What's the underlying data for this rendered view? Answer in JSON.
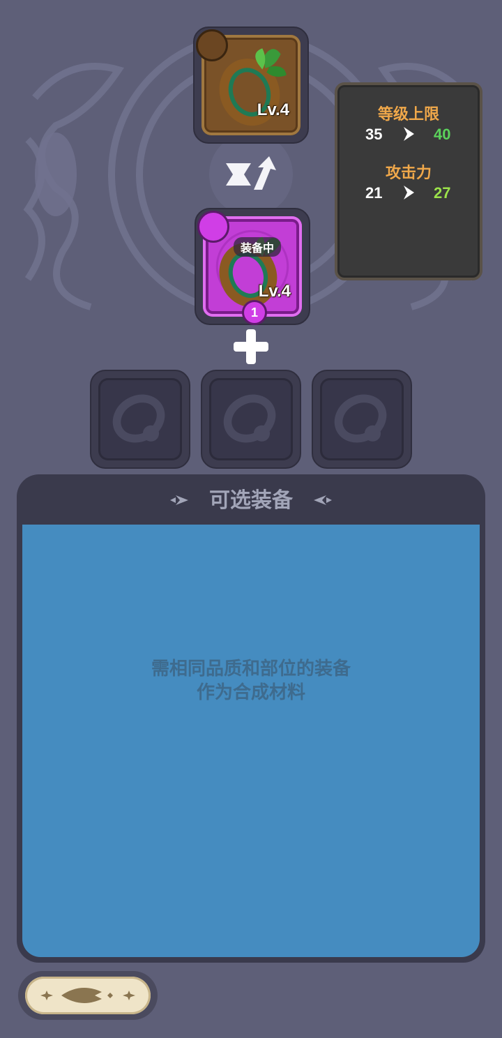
{
  "result_item": {
    "level": "Lv.4",
    "icon": "ring-icon"
  },
  "equipped_item": {
    "level": "Lv.4",
    "tag": "装备中",
    "count": "1",
    "icon": "ring-icon"
  },
  "stats": {
    "level_cap": {
      "label": "等级上限",
      "old": "35",
      "new": "40"
    },
    "attack": {
      "label": "攻击力",
      "old": "21",
      "new": "27"
    }
  },
  "material_slots": [
    {
      "icon": "ring-placeholder-icon"
    },
    {
      "icon": "ring-placeholder-icon"
    },
    {
      "icon": "ring-placeholder-icon"
    }
  ],
  "select_panel": {
    "title": "可选装备",
    "hint_line1": "需相同品质和部位的装备",
    "hint_line2": "作为合成材料"
  },
  "colors": {
    "background": "#5e5f78",
    "panel_blue": "#458cc0",
    "stat_label": "#f0a84a",
    "stat_green": "#5bd25b",
    "stat_lime": "#9be24a",
    "rarity_purple": "#c23ed6",
    "rarity_bronze": "#7a5228"
  }
}
